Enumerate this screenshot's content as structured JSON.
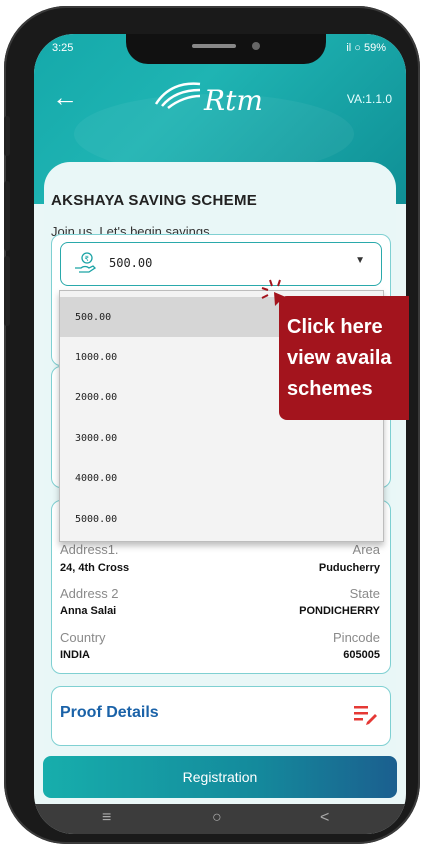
{
  "status": {
    "time": "3:25",
    "signal_battery": "il ○ 59%"
  },
  "header": {
    "logo_text": "Rtm",
    "version": "VA:1.1.0"
  },
  "scheme": {
    "title": "AKSHAYA SAVING SCHEME",
    "subtitle": "Join us. Let's begin savings"
  },
  "amount_select": {
    "value": "500.00",
    "icon": "rupee-hand-icon"
  },
  "dropdown": {
    "options": [
      "500.00",
      "1000.00",
      "2000.00",
      "3000.00",
      "4000.00",
      "5000.00"
    ],
    "selected_index": 0
  },
  "tooltip": {
    "line1": "Click here",
    "line2": "view availa",
    "line3": "schemes",
    "color": "#a3141d"
  },
  "address": {
    "address1_label": "Address1.",
    "address1_value": "24, 4th Cross",
    "area_label": "Area",
    "area_value": "Puducherry",
    "address2_label": "Address 2",
    "address2_value": "Anna Salai",
    "state_label": "State",
    "state_value": "PONDICHERRY",
    "country_label": "Country",
    "country_value": "INDIA",
    "pincode_label": "Pincode",
    "pincode_value": "605005"
  },
  "proof": {
    "title": "Proof Details",
    "icon": "edit-list-icon"
  },
  "registration": {
    "label": "Registration"
  },
  "navbar": {
    "menu": "≡",
    "home": "○",
    "back": "<"
  },
  "colors": {
    "primary": "#1fb4b3",
    "accent": "#1a62a8",
    "alert": "#e53935"
  }
}
